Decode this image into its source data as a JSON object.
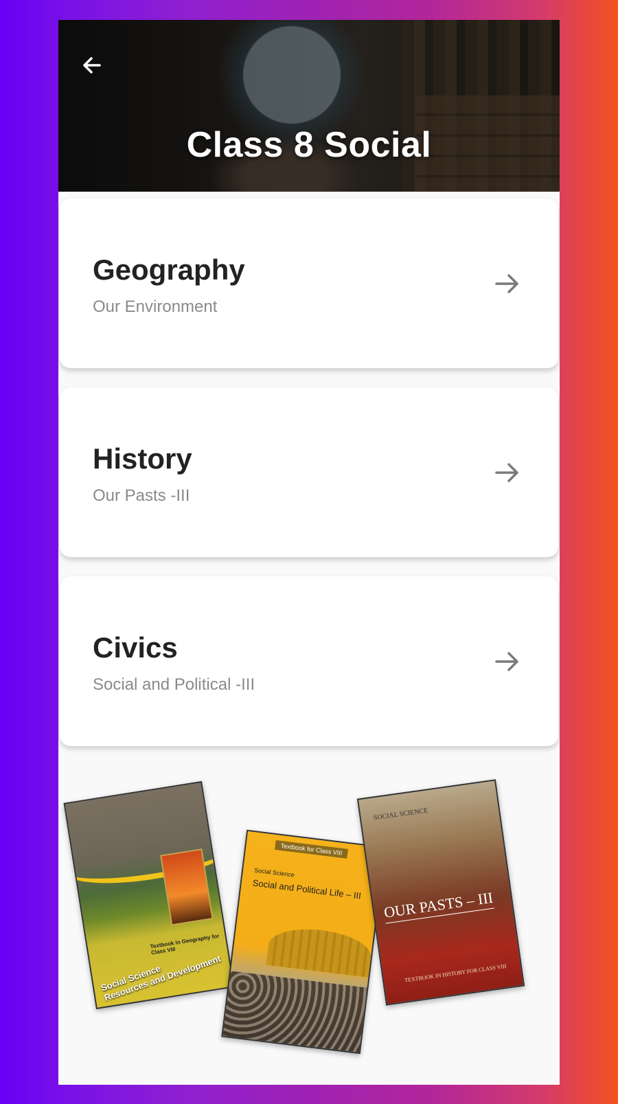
{
  "header": {
    "title": "Class 8 Social",
    "back_icon": "arrow-left-icon"
  },
  "subjects": [
    {
      "name": "Geography",
      "subtitle": "Our Environment",
      "icon": "arrow-right-icon"
    },
    {
      "name": "History",
      "subtitle": "Our Pasts -III",
      "icon": "arrow-right-icon"
    },
    {
      "name": "Civics",
      "subtitle": "Social and Political -III",
      "icon": "arrow-right-icon"
    }
  ],
  "books": [
    {
      "series": "Social Science",
      "title": "Resources and Development",
      "tag": "Textbook in Geography for Class VIII"
    },
    {
      "series": "Social Science",
      "title": "Social and Political Life – III",
      "tag": "Textbook for Class VIII"
    },
    {
      "series": "SOCIAL SCIENCE",
      "title": "OUR PASTS – III",
      "tag": "TEXTBOOK IN HISTORY FOR CLASS VIII"
    }
  ],
  "colors": {
    "background_start": "#6a00f4",
    "background_end": "#f4511e",
    "card_title": "#222222",
    "card_subtitle": "#8a8a8a",
    "arrow": "#7a7a7a"
  }
}
